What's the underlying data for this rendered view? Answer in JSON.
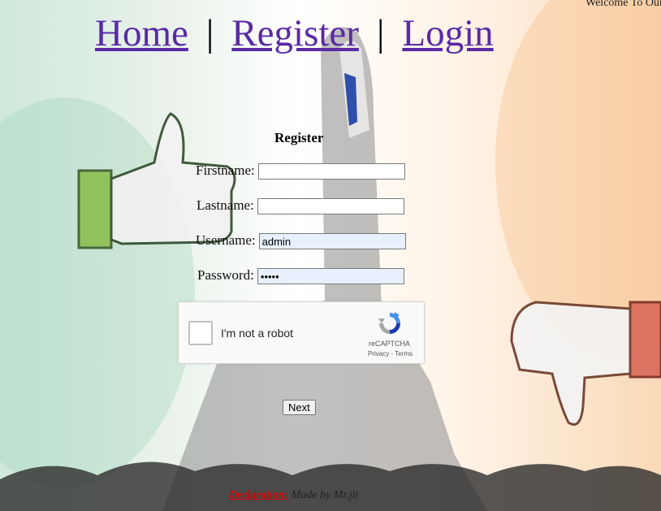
{
  "header": {
    "welcome": "Welcome To Our"
  },
  "nav": {
    "home": "Home",
    "register": "Register",
    "login": "Login",
    "separator": "|"
  },
  "form": {
    "title": "Register",
    "firstname_label": "Firstname:",
    "firstname_value": "",
    "lastname_label": "Lastname:",
    "lastname_value": "",
    "username_label": "Username:",
    "username_value": "admin",
    "password_label": "Password:",
    "password_value": "•••••",
    "next_label": "Next"
  },
  "captcha": {
    "text": "I'm not a robot",
    "brand": "reCAPTCHA",
    "privacy": "Privacy",
    "terms": "Terms",
    "links_sep": " - "
  },
  "footer": {
    "declaration_label": "Declaration:",
    "declaration_text": "Made by Mr.jit"
  }
}
